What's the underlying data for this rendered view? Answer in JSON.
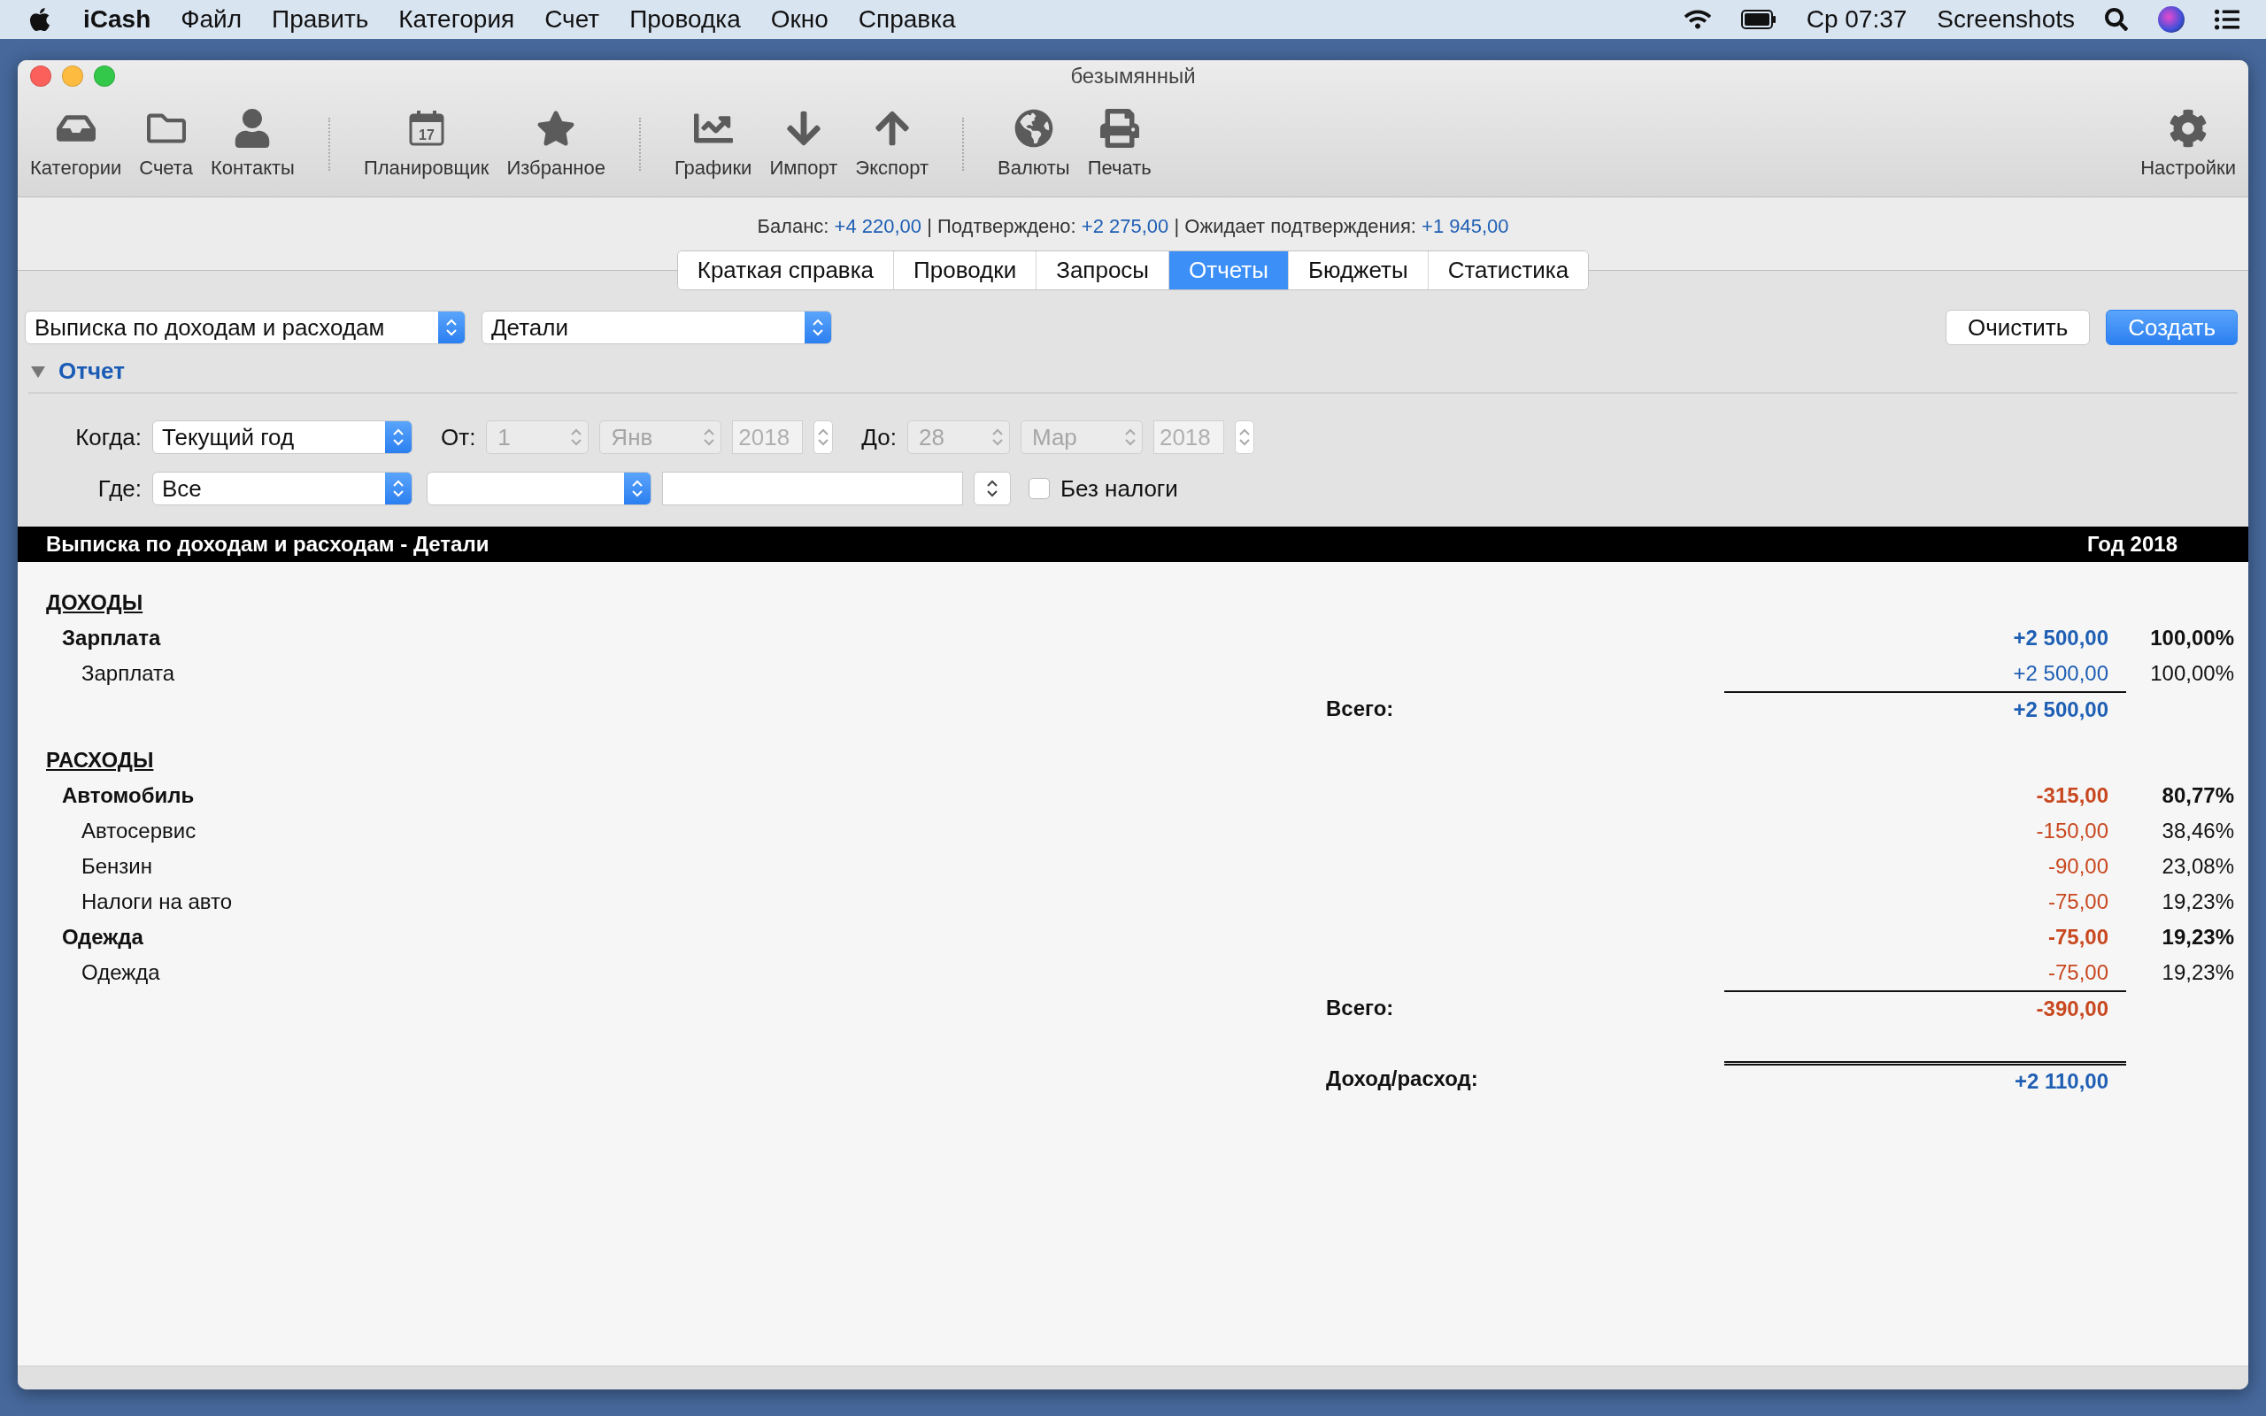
{
  "menubar": {
    "app": "iCash",
    "items": [
      "Файл",
      "Править",
      "Категория",
      "Счет",
      "Проводка",
      "Окно",
      "Справка"
    ],
    "clock": "Ср 07:37",
    "user": "Screenshots"
  },
  "window": {
    "title": "безымянный"
  },
  "toolbar": {
    "groups": [
      [
        {
          "label": "Категории"
        },
        {
          "label": "Счета"
        },
        {
          "label": "Контакты"
        }
      ],
      [
        {
          "label": "Планировщик",
          "icon_text": "17"
        },
        {
          "label": "Избранное"
        }
      ],
      [
        {
          "label": "Графики"
        },
        {
          "label": "Импорт"
        },
        {
          "label": "Экспорт"
        }
      ],
      [
        {
          "label": "Валюты"
        },
        {
          "label": "Печать"
        }
      ]
    ],
    "settings": {
      "label": "Настройки"
    }
  },
  "summary": {
    "separator": "|",
    "items": [
      {
        "label": "Баланс:",
        "value": "+4 220,00"
      },
      {
        "label": "Подтверждено:",
        "value": "+2 275,00"
      },
      {
        "label": "Ожидает подтверждения:",
        "value": "+1 945,00"
      }
    ]
  },
  "tabs": [
    {
      "label": "Краткая справка",
      "selected": false
    },
    {
      "label": "Проводки",
      "selected": false
    },
    {
      "label": "Запросы",
      "selected": false
    },
    {
      "label": "Отчеты",
      "selected": true
    },
    {
      "label": "Бюджеты",
      "selected": false
    },
    {
      "label": "Статистика",
      "selected": false
    }
  ],
  "report_controls": {
    "report_type": "Выписка по доходам и расходам",
    "detail": "Детали",
    "buttons": [
      {
        "label": "Очистить",
        "kind": "default"
      },
      {
        "label": "Создать",
        "kind": "primary"
      }
    ]
  },
  "section": {
    "title": "Отчет",
    "expanded": true
  },
  "filters": {
    "when": {
      "label": "Когда:",
      "value": "Текущий год"
    },
    "from": {
      "label": "От:",
      "day": "1",
      "month": "Янв",
      "year": "2018",
      "disabled": true
    },
    "to": {
      "label": "До:",
      "day": "28",
      "month": "Мар",
      "year": "2018",
      "disabled": true
    },
    "where": {
      "label": "Где:",
      "value": "Все"
    },
    "checkbox": {
      "label": "Без налоги",
      "checked": false
    }
  },
  "report": {
    "title": "Выписка по доходам и расходам - Детали",
    "period": "Год 2018",
    "sections": [
      {
        "kind": "income",
        "heading": "ДОХОДЫ",
        "total_label": "Всего:",
        "total": "+2 500,00",
        "groups": [
          {
            "name": "Зарплата",
            "amount": "+2 500,00",
            "percent": "100,00%",
            "items": [
              {
                "name": "Зарплата",
                "amount": "+2 500,00",
                "percent": "100,00%"
              }
            ]
          }
        ]
      },
      {
        "kind": "expense",
        "heading": "РАСХОДЫ",
        "total_label": "Всего:",
        "total": "-390,00",
        "groups": [
          {
            "name": "Автомобиль",
            "amount": "-315,00",
            "percent": "80,77%",
            "items": [
              {
                "name": "Автосервис",
                "amount": "-150,00",
                "percent": "38,46%"
              },
              {
                "name": "Бензин",
                "amount": "-90,00",
                "percent": "23,08%"
              },
              {
                "name": "Налоги на авто",
                "amount": "-75,00",
                "percent": "19,23%"
              }
            ]
          },
          {
            "name": "Одежда",
            "amount": "-75,00",
            "percent": "19,23%",
            "items": [
              {
                "name": "Одежда",
                "amount": "-75,00",
                "percent": "19,23%"
              }
            ]
          }
        ]
      }
    ],
    "net": {
      "kind": "income",
      "label": "Доход/расход:",
      "amount": "+2 110,00"
    }
  }
}
